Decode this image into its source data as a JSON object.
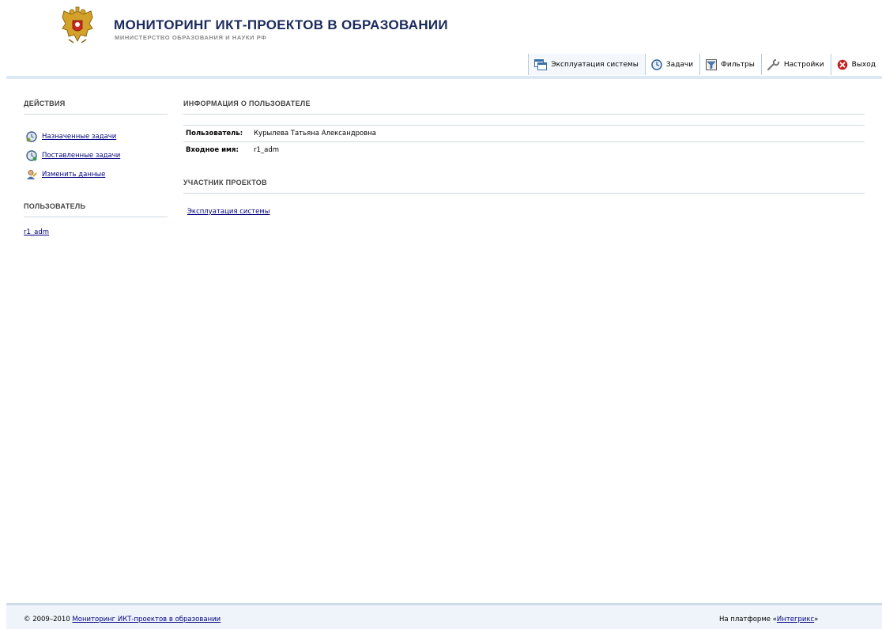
{
  "header": {
    "title": "МОНИТОРИНГ ИКТ-ПРОЕКТОВ В ОБРАЗОВАНИИ",
    "subtitle": "МИНИСТЕРСТВО ОБРАЗОВАНИЯ И НАУКИ РФ",
    "logo_icon": "russian-coat-of-arms-icon"
  },
  "tabs": [
    {
      "label": "Эксплуатация системы",
      "icon": "windows-icon",
      "active": true
    },
    {
      "label": "Задачи",
      "icon": "clock-icon"
    },
    {
      "label": "Фильтры",
      "icon": "filter-icon"
    },
    {
      "label": "Настройки",
      "icon": "wrench-icon"
    },
    {
      "label": "Выход",
      "icon": "exit-icon"
    }
  ],
  "sidebar": {
    "actions_title": "ДЕЙСТВИЯ",
    "actions": [
      {
        "label": "Назначенные задачи",
        "icon": "assigned-tasks-icon"
      },
      {
        "label": "Поставленные задачи",
        "icon": "created-tasks-icon"
      },
      {
        "label": "Изменить данные",
        "icon": "edit-user-icon"
      }
    ],
    "user_title": "ПОЛЬЗОВАТЕЛЬ",
    "user_link": "r1_adm"
  },
  "main": {
    "info_title": "ИНФОРМАЦИЯ О ПОЛЬЗОВАТЕЛЕ",
    "info_rows": [
      {
        "key": "Пользователь:",
        "value": "Курылева Татьяна Александровна"
      },
      {
        "key": "Входное имя:",
        "value": "r1_adm"
      }
    ],
    "projects_title": "УЧАСТНИК ПРОЕКТОВ",
    "projects": [
      "Эксплуатация системы"
    ]
  },
  "footer": {
    "copyright_prefix": "© 2009–2010 ",
    "copyright_link": "Мониторинг ИКТ-проектов в образовании",
    "platform_prefix": "На платформе «",
    "platform_link": "Интегрикс",
    "platform_suffix": "»"
  },
  "colors": {
    "title": "#1b2a5c",
    "link": "#000080",
    "accent_light": "#dce8f3",
    "divider": "#cfd9e3"
  }
}
